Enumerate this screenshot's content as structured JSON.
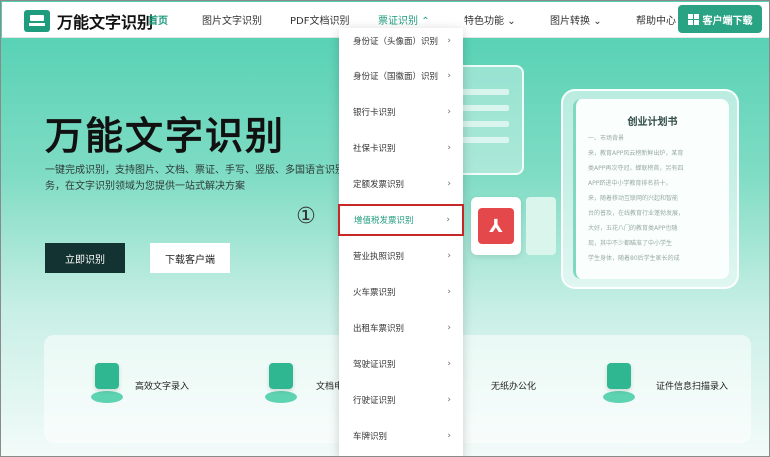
{
  "nav": {
    "logo_text": "万能文字识别",
    "items": [
      "首页",
      "图片文字识别",
      "PDF文档识别",
      "票证识别",
      "特色功能",
      "图片转换",
      "帮助中心"
    ],
    "download_label": "客户端下载"
  },
  "hero": {
    "title": "万能文字识别",
    "desc": "一键完成识别，支持图片、文档、票证、手写、竖版、多国语言识别转换服务，在文字识别领域为您提供一站式解决方案",
    "primary_btn": "立即识别",
    "secondary_btn": "下载客户端"
  },
  "doc_card": {
    "title": "创业计划书",
    "lines": [
      "一、市场背景",
      "来，教育APP风云榜新鲜出炉，某育",
      "类APP再次夺冠，蝉联榜首，另有四",
      "APP跻进中小学教育排名前十，",
      "来，随着移动互联网的兴起和智能",
      "台的普及，在线教育行业蓬勃发展，",
      "大好，五花八门的教育类APP也随",
      "现，其中不少都瞄准了中小学生",
      "学生身体，随着80后学生家长的成"
    ]
  },
  "features": [
    "高效文字录入",
    "文档电",
    "无纸办公化",
    "证件信息扫描录入"
  ],
  "menu": {
    "items": [
      "身份证（头像面）识别",
      "身份证（国徽面）识别",
      "银行卡识别",
      "社保卡识别",
      "定额发票识别",
      "增值税发票识别",
      "营业执照识别",
      "火车票识别",
      "出租车票识别",
      "驾驶证识别",
      "行驶证识别",
      "车牌识别"
    ],
    "highlighted": "增值税发票识别"
  },
  "annotation": "①",
  "colors": {
    "accent": "#2aa384",
    "highlight_border": "#c62828",
    "dark_btn": "#123331"
  }
}
